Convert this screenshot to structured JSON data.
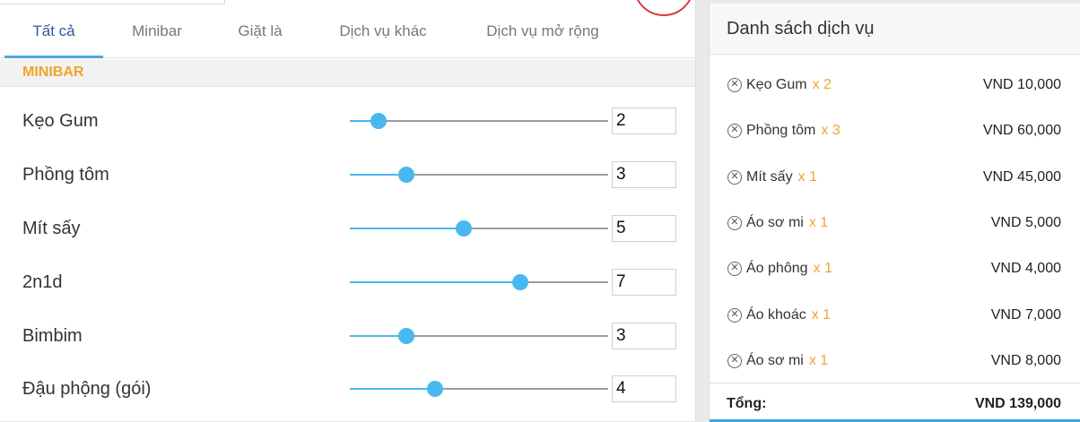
{
  "tabs": [
    {
      "label": "Tất cả",
      "active": true
    },
    {
      "label": "Minibar",
      "active": false
    },
    {
      "label": "Giặt là",
      "active": false
    },
    {
      "label": "Dịch vụ khác",
      "active": false
    },
    {
      "label": "Dịch vụ mở rộng",
      "active": false
    }
  ],
  "section": {
    "title": "MINIBAR"
  },
  "items": [
    {
      "name": "Kẹo Gum",
      "quantity": "2",
      "slider_level": 0.11
    },
    {
      "name": "Phồng tôm",
      "quantity": "3",
      "slider_level": 0.22
    },
    {
      "name": "Mít sấy",
      "quantity": "5",
      "slider_level": 0.44
    },
    {
      "name": "2n1d",
      "quantity": "7",
      "slider_level": 0.66
    },
    {
      "name": "Bimbim",
      "quantity": "3",
      "slider_level": 0.22
    },
    {
      "name": "Đậu phộng (gói)",
      "quantity": "4",
      "slider_level": 0.33
    }
  ],
  "service_list": {
    "title": "Danh sách dịch vụ",
    "entries": [
      {
        "name": "Kẹo Gum",
        "mult": "x 2",
        "price": "VND 10,000"
      },
      {
        "name": "Phồng tôm",
        "mult": "x 3",
        "price": "VND 60,000"
      },
      {
        "name": "Mít sấy",
        "mult": "x 1",
        "price": "VND 45,000"
      },
      {
        "name": "Áo sơ mi",
        "mult": "x 1",
        "price": "VND 5,000"
      },
      {
        "name": "Áo phông",
        "mult": "x 1",
        "price": "VND 4,000"
      },
      {
        "name": "Áo khoác",
        "mult": "x 1",
        "price": "VND 7,000"
      },
      {
        "name": "Áo sơ mi",
        "mult": "x 1",
        "price": "VND 8,000"
      }
    ],
    "total_label": "Tổng:",
    "total_value": "VND 139,000"
  },
  "icons": {
    "remove": "close-circle-icon"
  },
  "colors": {
    "accent_blue": "#49b8f0",
    "tab_active": "#2c5aa0",
    "section_orange": "#f0a42c",
    "highlight_circle": "#d63838"
  }
}
